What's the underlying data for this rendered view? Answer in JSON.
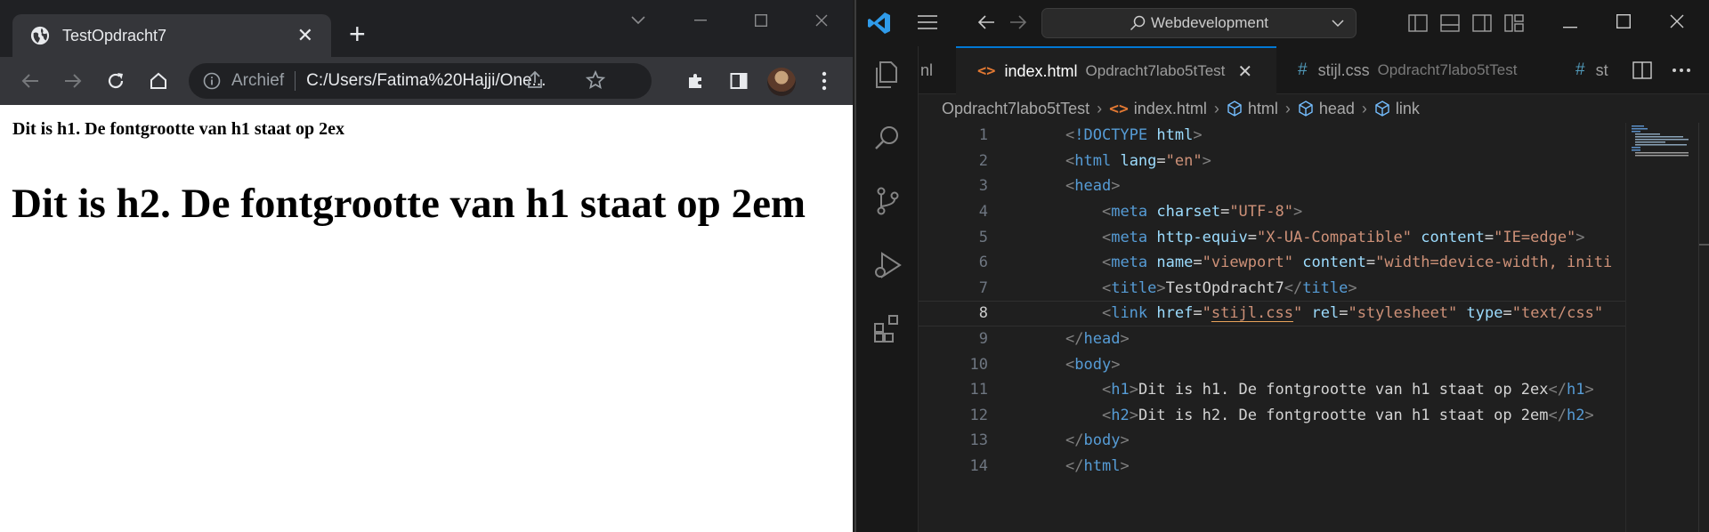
{
  "browser": {
    "tab_title": "TestOpdracht7",
    "tab_close": "✕",
    "new_tab": "+",
    "address_label": "Archief",
    "address_url": "C:/Users/Fatima%20Hajji/One...",
    "page": {
      "h1": "Dit is h1. De fontgrootte van h1 staat op 2ex",
      "h2": "Dit is h2. De fontgrootte van h1 staat op 2em"
    }
  },
  "vscode": {
    "command_center": "Webdevelopment",
    "tabs": [
      {
        "name": "nl",
        "dir": ""
      },
      {
        "name": "index.html",
        "dir": "Opdracht7labo5tTest",
        "close": "✕"
      },
      {
        "name": "stijl.css",
        "dir": "Opdracht7labo5tTest"
      },
      {
        "name": "st",
        "dir": ""
      }
    ],
    "breadcrumb": [
      "Opdracht7labo5tTest",
      "index.html",
      "html",
      "head",
      "link"
    ],
    "line_numbers": [
      "1",
      "2",
      "3",
      "4",
      "5",
      "6",
      "7",
      "8",
      "9",
      "10",
      "11",
      "12",
      "13",
      "14"
    ],
    "active_line": "8",
    "code": {
      "l1_doctype": "!DOCTYPE",
      "l1_html": "html",
      "l2_tag": "html",
      "l2_attr": "lang",
      "l2_val": "\"en\"",
      "l3_tag": "head",
      "l4_tag": "meta",
      "l4_attr": "charset",
      "l4_val": "\"UTF-8\"",
      "l5_tag": "meta",
      "l5_attr1": "http-equiv",
      "l5_val1": "\"X-UA-Compatible\"",
      "l5_attr2": "content",
      "l5_val2": "\"IE=edge\"",
      "l6_tag": "meta",
      "l6_attr1": "name",
      "l6_val1": "\"viewport\"",
      "l6_attr2": "content",
      "l6_val2": "\"width=device-width, initi",
      "l7_tag": "title",
      "l7_text": "TestOpdracht7",
      "l7_close": "title",
      "l8_tag": "link",
      "l8_attr1": "href",
      "l8_val1_q": "\"",
      "l8_val1": "stijl.css",
      "l8_val1_q2": "\"",
      "l8_attr2": "rel",
      "l8_val2": "\"stylesheet\"",
      "l8_attr3": "type",
      "l8_val3": "\"text/css\"",
      "l9_tag": "head",
      "l10_tag": "body",
      "l11_tag": "h1",
      "l11_text": "Dit is h1. De fontgrootte van h1 staat op 2ex",
      "l11_close": "h1",
      "l12_tag": "h2",
      "l12_text": "Dit is h2. De fontgrootte van h1 staat op 2em",
      "l12_close": "h2",
      "l13_tag": "body",
      "l14_tag": "html"
    }
  },
  "colors": {
    "vscode_accent": "#0078d4",
    "html_icon": "#e37933",
    "css_icon": "#519aba"
  }
}
